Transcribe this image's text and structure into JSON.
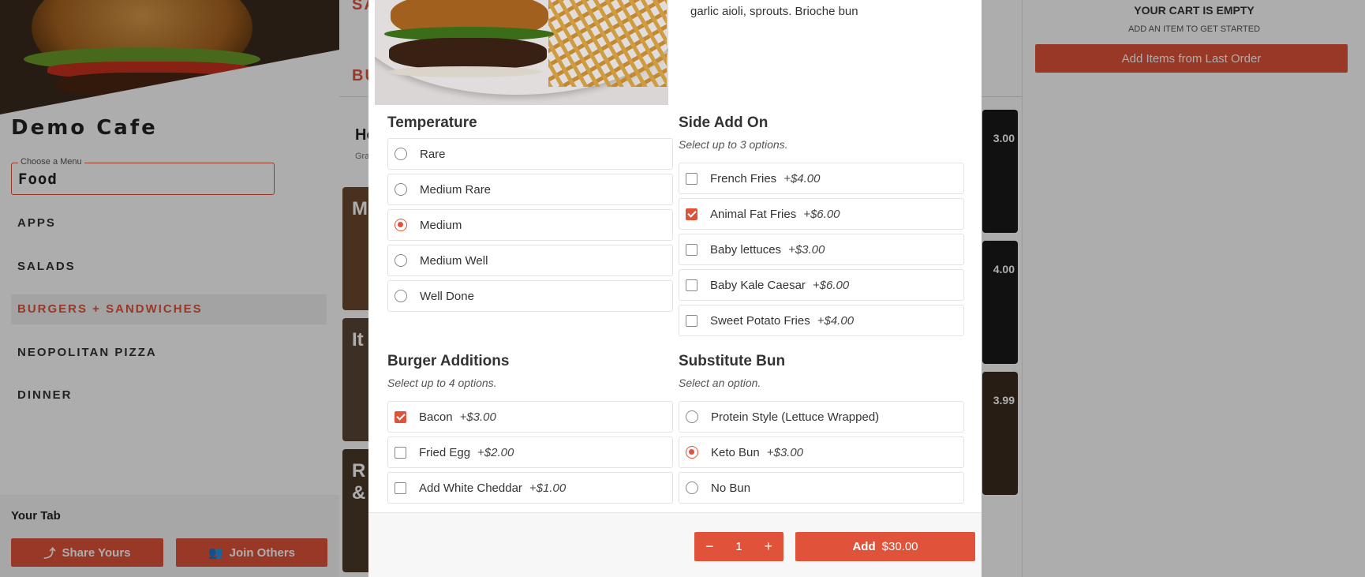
{
  "sidebar": {
    "cafe_name": "Demo Cafe",
    "menu_select": {
      "legend": "Choose a Menu",
      "value": "Food"
    },
    "categories": [
      {
        "label": "APPS"
      },
      {
        "label": "SALADS"
      },
      {
        "label": "BURGERS + SANDWICHES"
      },
      {
        "label": "NEOPOLITAN PIZZA"
      },
      {
        "label": "DINNER"
      }
    ],
    "your_tab": {
      "title": "Your Tab",
      "share_label": "Share Yours",
      "join_label": "Join Others"
    }
  },
  "content": {
    "section_title_top": "SA",
    "section_title": "BU",
    "item_heading": "Ho",
    "item_sub": "Gra",
    "cards": [
      {
        "text": "M"
      },
      {
        "text": "It"
      },
      {
        "text": "R \n&"
      }
    ],
    "right_prices": [
      "3.00",
      "4.00",
      "3.99"
    ]
  },
  "cart": {
    "empty_title": "YOUR CART IS EMPTY",
    "empty_sub": "ADD AN ITEM TO GET STARTED",
    "last_order_label": "Add Items from Last Order"
  },
  "modal": {
    "description": "garlic aioli, sprouts. Brioche bun",
    "temperature": {
      "title": "Temperature",
      "options": [
        {
          "label": "Rare",
          "selected": false
        },
        {
          "label": "Medium Rare",
          "selected": false
        },
        {
          "label": "Medium",
          "selected": true
        },
        {
          "label": "Medium Well",
          "selected": false
        },
        {
          "label": "Well Done",
          "selected": false
        }
      ]
    },
    "side_add_on": {
      "title": "Side Add On",
      "subtitle": "Select up to 3 options.",
      "options": [
        {
          "label": "French Fries",
          "price": "+$4.00",
          "checked": false
        },
        {
          "label": "Animal Fat Fries",
          "price": "+$6.00",
          "checked": true
        },
        {
          "label": "Baby lettuces",
          "price": "+$3.00",
          "checked": false
        },
        {
          "label": "Baby Kale Caesar",
          "price": "+$6.00",
          "checked": false
        },
        {
          "label": "Sweet Potato Fries",
          "price": "+$4.00",
          "checked": false
        }
      ]
    },
    "burger_additions": {
      "title": "Burger Additions",
      "subtitle": "Select up to 4 options.",
      "options": [
        {
          "label": "Bacon",
          "price": "+$3.00",
          "checked": true
        },
        {
          "label": "Fried Egg",
          "price": "+$2.00",
          "checked": false
        },
        {
          "label": "Add White Cheddar",
          "price": "+$1.00",
          "checked": false
        }
      ]
    },
    "substitute_bun": {
      "title": "Substitute Bun",
      "subtitle": "Select an option.",
      "options": [
        {
          "label": "Protein Style (Lettuce Wrapped)",
          "price": "",
          "selected": false
        },
        {
          "label": "Keto Bun",
          "price": "+$3.00",
          "selected": true
        },
        {
          "label": "No Bun",
          "price": "",
          "selected": false
        }
      ]
    },
    "footer": {
      "quantity": "1",
      "minus": "−",
      "plus": "+",
      "add_label": "Add",
      "add_price": "$30.00"
    }
  },
  "colors": {
    "accent": "#e0533a",
    "overlay": "rgba(0,0,0,0.32)"
  }
}
